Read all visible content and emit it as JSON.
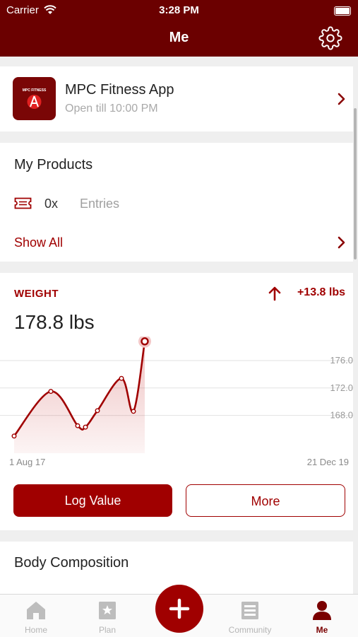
{
  "status": {
    "carrier": "Carrier",
    "time": "3:28 PM"
  },
  "nav": {
    "title": "Me",
    "settings_icon": "gear-icon"
  },
  "gym": {
    "name": "MPC Fitness App",
    "hours": "Open till 10:00 PM",
    "logo_text": "MPC FITNESS"
  },
  "products": {
    "title": "My Products",
    "count": "0x",
    "entries_label": "Entries",
    "show_all": "Show All"
  },
  "weight": {
    "label": "WEIGHT",
    "delta": "+13.8 lbs",
    "current": "178.8 lbs",
    "log_button": "Log Value",
    "more_button": "More"
  },
  "chart_data": {
    "type": "line",
    "x_start_label": "1 Aug 17",
    "x_end_label": "21 Dec 19",
    "y_ticks": [
      "176.0",
      "172.0",
      "168.0"
    ],
    "values": [
      165.0,
      171.5,
      166.5,
      166.3,
      168.7,
      173.4,
      168.6,
      178.8
    ],
    "ylim": [
      162.5,
      179.5
    ],
    "color": "#a00000"
  },
  "body_composition": {
    "title": "Body Composition"
  },
  "tabbar": {
    "items": [
      {
        "label": "Home",
        "icon": "home-icon"
      },
      {
        "label": "Plan",
        "icon": "plan-icon"
      },
      {
        "label": "Community",
        "icon": "community-icon"
      },
      {
        "label": "Me",
        "icon": "person-icon"
      }
    ],
    "add_icon": "plus-icon"
  }
}
